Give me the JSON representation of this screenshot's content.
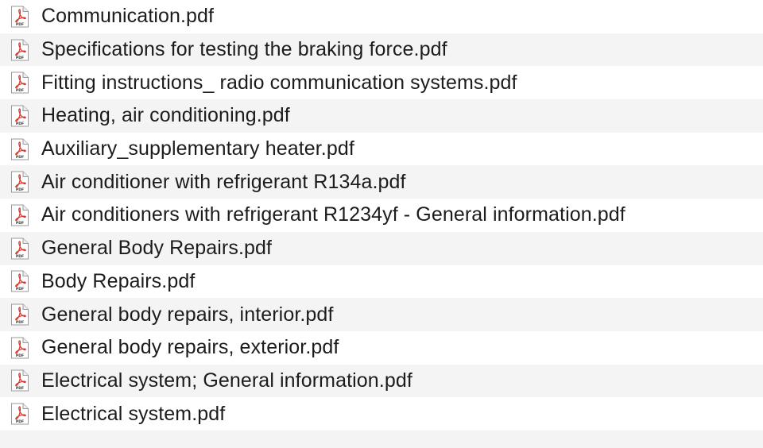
{
  "files": [
    {
      "name": "Communication.pdf",
      "icon": "pdf-file-icon"
    },
    {
      "name": "Specifications for testing the braking force.pdf",
      "icon": "pdf-file-icon"
    },
    {
      "name": "Fitting instructions_ radio communication systems.pdf",
      "icon": "pdf-file-icon"
    },
    {
      "name": "Heating, air conditioning.pdf",
      "icon": "pdf-file-icon"
    },
    {
      "name": "Auxiliary_supplementary heater.pdf",
      "icon": "pdf-file-icon"
    },
    {
      "name": "Air conditioner with refrigerant R134a.pdf",
      "icon": "pdf-file-icon"
    },
    {
      "name": "Air conditioners with refrigerant R1234yf - General information.pdf",
      "icon": "pdf-file-icon"
    },
    {
      "name": "General Body Repairs.pdf",
      "icon": "pdf-file-icon"
    },
    {
      "name": "Body Repairs.pdf",
      "icon": "pdf-file-icon"
    },
    {
      "name": "General body repairs, interior.pdf",
      "icon": "pdf-file-icon"
    },
    {
      "name": "General body repairs, exterior.pdf",
      "icon": "pdf-file-icon"
    },
    {
      "name": "Electrical system; General information.pdf",
      "icon": "pdf-file-icon"
    },
    {
      "name": "Electrical system.pdf",
      "icon": "pdf-file-icon"
    }
  ],
  "icon_label": "PDF",
  "colors": {
    "row_even": "#ffffff",
    "row_odd": "#f4f4f4",
    "text": "#1c1c1c",
    "pdf_accent": "#d8352a"
  }
}
